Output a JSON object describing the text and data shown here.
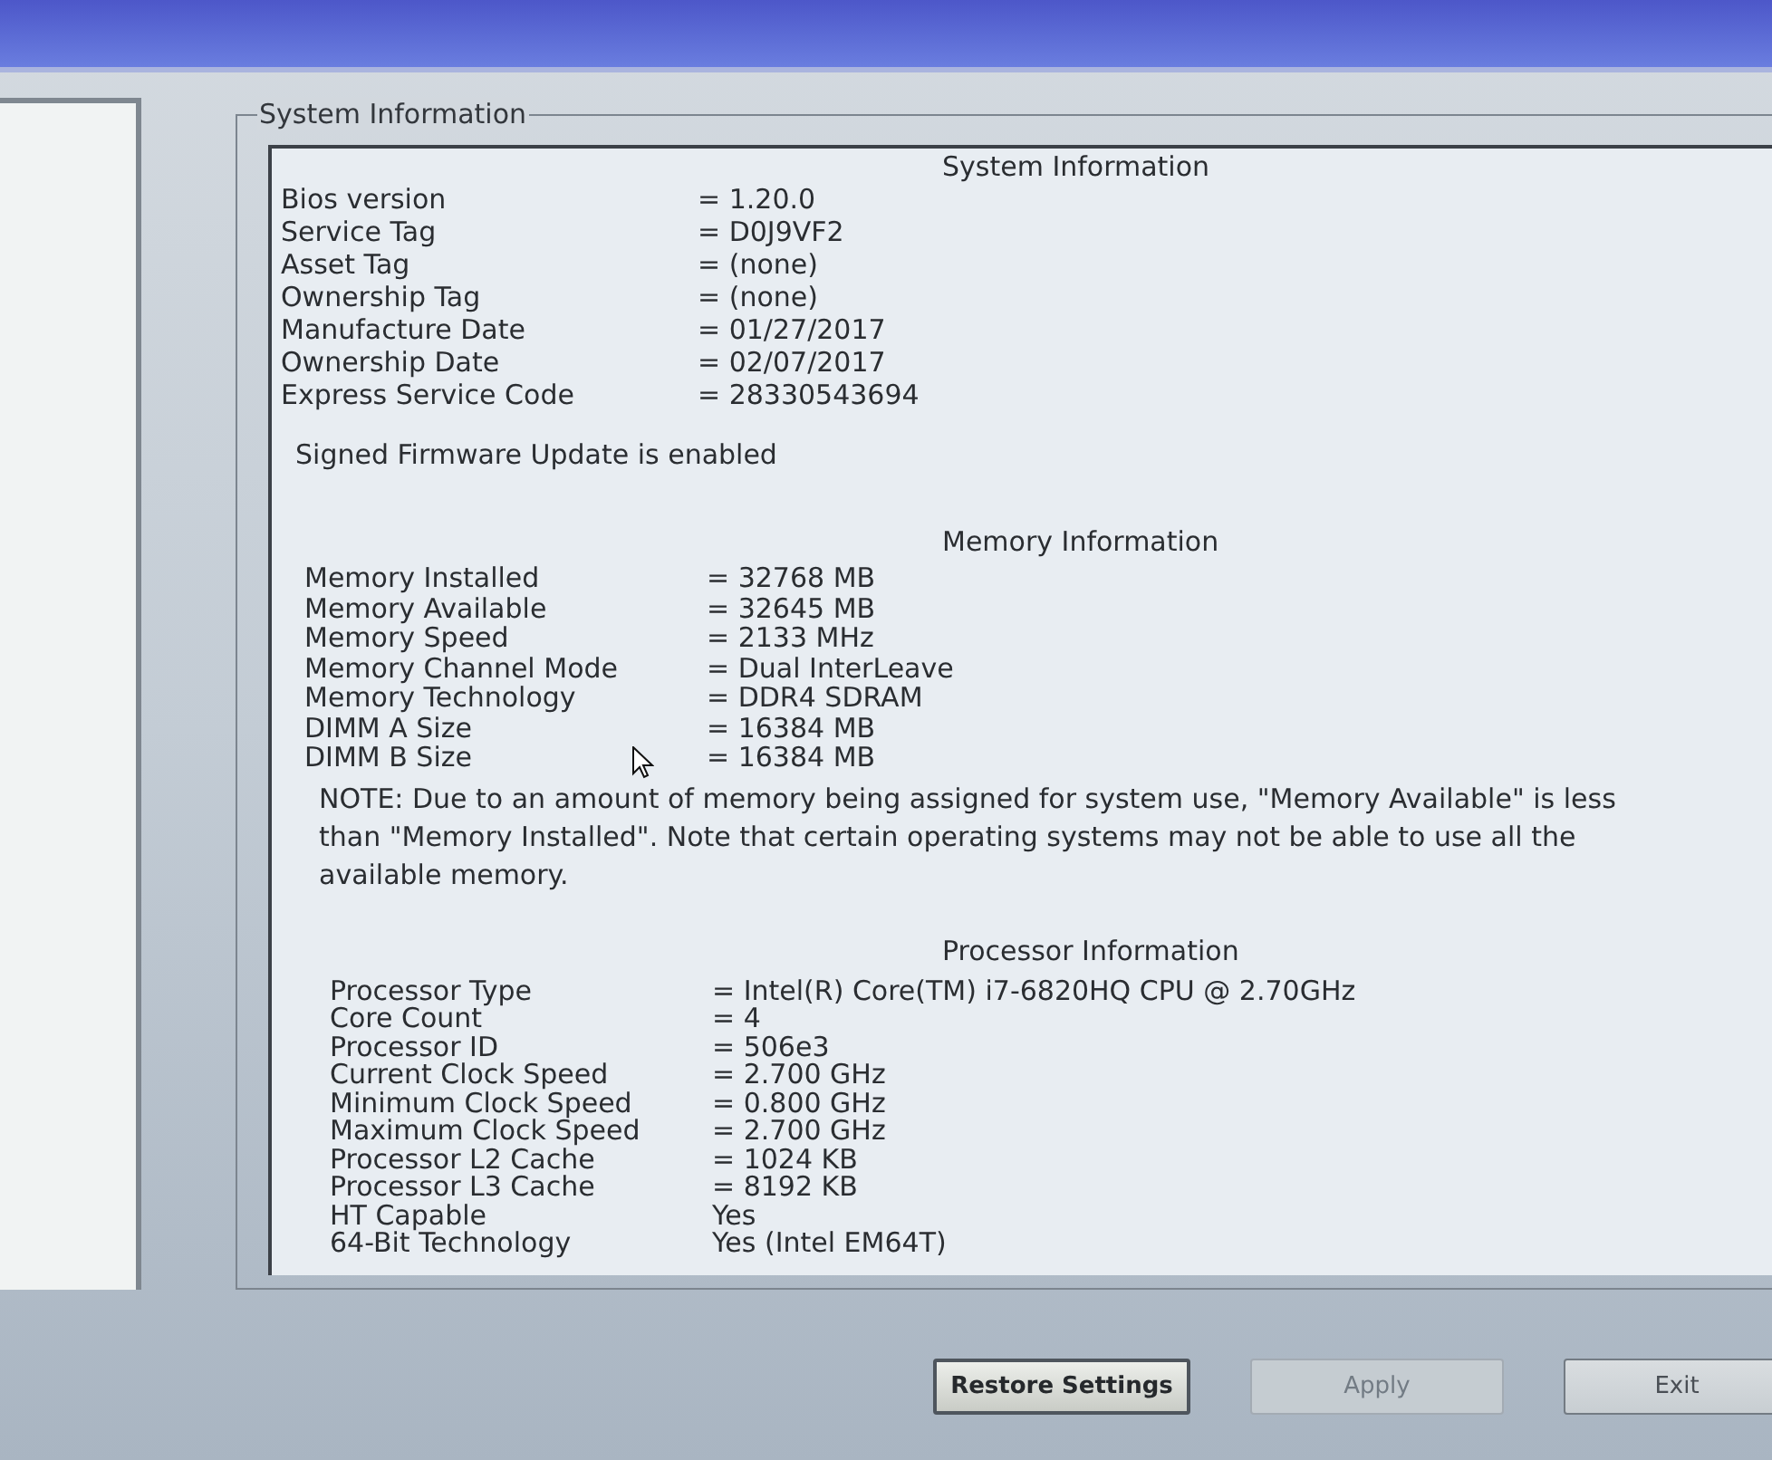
{
  "group_box": {
    "title": "System Information"
  },
  "sections": [
    {
      "heading": "System Information",
      "rows": [
        {
          "label": "Bios version",
          "value": "= 1.20.0"
        },
        {
          "label": "Service Tag",
          "value": "= D0J9VF2"
        },
        {
          "label": "Asset Tag",
          "value": "= (none)"
        },
        {
          "label": "Ownership Tag",
          "value": "= (none)"
        },
        {
          "label": "Manufacture Date",
          "value": "= 01/27/2017"
        },
        {
          "label": "Ownership Date",
          "value": "= 02/07/2017"
        },
        {
          "label": "Express Service Code",
          "value": "= 28330543694"
        }
      ],
      "note": "Signed Firmware Update is enabled"
    },
    {
      "heading": "Memory Information",
      "rows": [
        {
          "label": "Memory Installed",
          "value": "= 32768 MB"
        },
        {
          "label": "Memory Available",
          "value": "= 32645 MB"
        },
        {
          "label": "Memory Speed",
          "value": "= 2133 MHz"
        },
        {
          "label": "Memory Channel Mode",
          "value": "= Dual InterLeave"
        },
        {
          "label": "Memory Technology",
          "value": "= DDR4 SDRAM"
        },
        {
          "label": "DIMM A Size",
          "value": "= 16384 MB"
        },
        {
          "label": "DIMM B Size",
          "value": "= 16384 MB"
        }
      ],
      "note": "NOTE: Due to an amount of memory being assigned for system use, \"Memory Available\" is less than \"Memory Installed\". Note that certain operating systems may not be able to use all the available memory."
    },
    {
      "heading": "Processor Information",
      "rows": [
        {
          "label": "Processor Type",
          "value": "= Intel(R) Core(TM) i7-6820HQ CPU @ 2.70GHz"
        },
        {
          "label": "Core Count",
          "value": "= 4"
        },
        {
          "label": "Processor ID",
          "value": "= 506e3"
        },
        {
          "label": "Current Clock Speed",
          "value": "= 2.700 GHz"
        },
        {
          "label": "Minimum Clock Speed",
          "value": "= 0.800 GHz"
        },
        {
          "label": "Maximum Clock Speed",
          "value": "= 2.700 GHz"
        },
        {
          "label": "Processor L2 Cache",
          "value": "= 1024 KB"
        },
        {
          "label": "Processor L3 Cache",
          "value": "= 8192 KB"
        },
        {
          "label": "HT Capable",
          "value": "Yes"
        },
        {
          "label": "64-Bit Technology",
          "value": "Yes (Intel EM64T)"
        }
      ]
    }
  ],
  "buttons": [
    {
      "label": "Restore Settings",
      "focused": true,
      "disabled": false
    },
    {
      "label": "Apply",
      "focused": false,
      "disabled": true
    },
    {
      "label": "Exit",
      "focused": false,
      "disabled": false
    }
  ]
}
